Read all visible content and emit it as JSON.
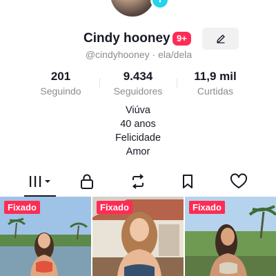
{
  "profile": {
    "display_name": "Cindy hooney",
    "notification_badge": "9+",
    "handle_line": "@cindyhooney · ela/dela",
    "avatar_add_icon": "plus-icon",
    "edit_icon": "pencil-icon"
  },
  "stats": [
    {
      "value": "201",
      "label": "Seguindo"
    },
    {
      "value": "9.434",
      "label": "Seguidores"
    },
    {
      "value": "11,9 mil",
      "label": "Curtidas"
    }
  ],
  "bio": [
    "Viúva",
    "40 anos",
    "Felicidade",
    "Amor"
  ],
  "tabs": [
    {
      "icon": "grid-icon",
      "selected": true
    },
    {
      "icon": "lock-icon"
    },
    {
      "icon": "repost-icon"
    },
    {
      "icon": "bookmark-icon"
    },
    {
      "icon": "heart-icon"
    }
  ],
  "videos": [
    {
      "pinned_label": "Fixado"
    },
    {
      "pinned_label": "Fixado"
    },
    {
      "pinned_label": "Fixado"
    }
  ],
  "colors": {
    "accent": "#fe2c55",
    "avatar_add": "#20d5ec",
    "secondary_text": "#8a8b91"
  }
}
